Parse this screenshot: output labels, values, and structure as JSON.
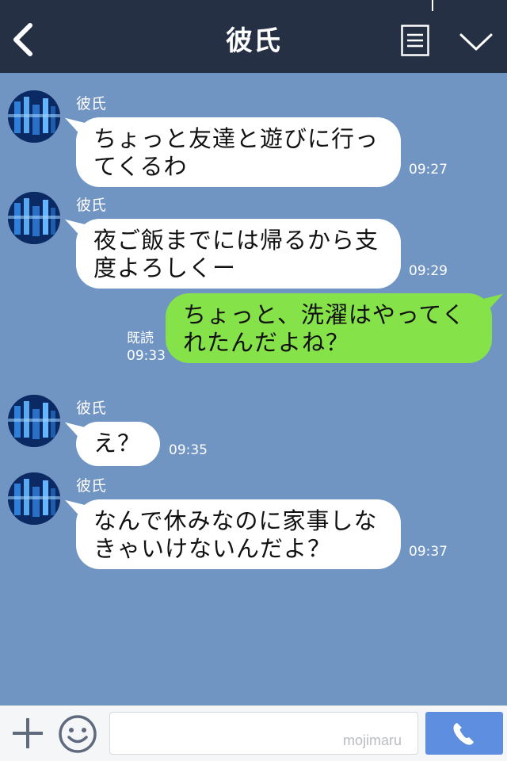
{
  "header": {
    "title": "彼氏"
  },
  "messages": [
    {
      "sender": "彼氏",
      "lines": [
        "ちょっと友達と遊びに行っ",
        "てくるわ"
      ],
      "time": "09:27"
    },
    {
      "sender": "彼氏",
      "lines": [
        "夜ご飯までには帰るから支",
        "度よろしくー"
      ],
      "time": "09:29"
    },
    {
      "lines": [
        "ちょっと、洗濯はやってく",
        "れたんだよね？"
      ],
      "read_label": "既読",
      "time": "09:33"
    },
    {
      "sender": "彼氏",
      "lines": [
        "え？"
      ],
      "time": "09:35"
    },
    {
      "sender": "彼氏",
      "lines": [
        "なんで休みなのに家事しな",
        "きゃいけないんだよ？"
      ],
      "time": "09:37"
    }
  ],
  "input": {
    "placeholder": "",
    "watermark": "mojimaru"
  },
  "icons": {
    "back": "chevron-left-icon",
    "menu": "list-icon",
    "collapse": "chevron-down-icon",
    "plus": "plus-icon",
    "emoji": "smiley-icon",
    "call": "phone-icon"
  },
  "colors": {
    "header_bg": "#253044",
    "chat_bg": "#7195c3",
    "incoming_bubble": "#ffffff",
    "outgoing_bubble": "#85e249",
    "call_button": "#5e8ee0"
  }
}
